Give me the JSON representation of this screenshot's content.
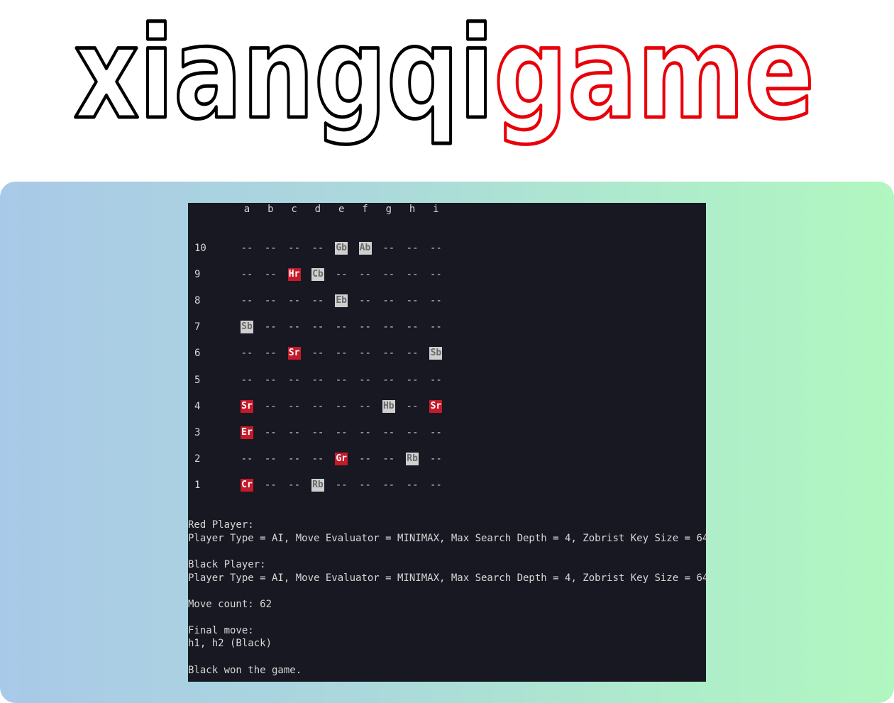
{
  "title": {
    "part1": "xiangqi",
    "part2": "game",
    "color1": "#000000",
    "color2": "#e8000a"
  },
  "panel_gradient": [
    "#a9c9e8",
    "#b1f7c0"
  ],
  "terminal": {
    "columns": [
      "a",
      "b",
      "c",
      "d",
      "e",
      "f",
      "g",
      "h",
      "i"
    ],
    "rows": [
      {
        "label": "10",
        "cells": [
          "--",
          "--",
          "--",
          "--",
          "Gb",
          "Ab",
          "--",
          "--",
          "--"
        ]
      },
      {
        "label": "9",
        "cells": [
          "--",
          "--",
          "Hr",
          "Cb",
          "--",
          "--",
          "--",
          "--",
          "--"
        ]
      },
      {
        "label": "8",
        "cells": [
          "--",
          "--",
          "--",
          "--",
          "Eb",
          "--",
          "--",
          "--",
          "--"
        ]
      },
      {
        "label": "7",
        "cells": [
          "Sb",
          "--",
          "--",
          "--",
          "--",
          "--",
          "--",
          "--",
          "--"
        ]
      },
      {
        "label": "6",
        "cells": [
          "--",
          "--",
          "Sr",
          "--",
          "--",
          "--",
          "--",
          "--",
          "Sb"
        ]
      },
      {
        "label": "5",
        "cells": [
          "--",
          "--",
          "--",
          "--",
          "--",
          "--",
          "--",
          "--",
          "--"
        ]
      },
      {
        "label": "4",
        "cells": [
          "Sr",
          "--",
          "--",
          "--",
          "--",
          "--",
          "Hb",
          "--",
          "Sr"
        ]
      },
      {
        "label": "3",
        "cells": [
          "Er",
          "--",
          "--",
          "--",
          "--",
          "--",
          "--",
          "--",
          "--"
        ]
      },
      {
        "label": "2",
        "cells": [
          "--",
          "--",
          "--",
          "--",
          "Gr",
          "--",
          "--",
          "Rb",
          "--"
        ]
      },
      {
        "label": "1",
        "cells": [
          "Cr",
          "--",
          "--",
          "Rb",
          "--",
          "--",
          "--",
          "--",
          "--"
        ]
      }
    ],
    "red_player_header": "Red Player:",
    "red_player_info": "Player Type = AI, Move Evaluator = MINIMAX, Max Search Depth = 4, Zobrist Key Size = 64",
    "black_player_header": "Black Player:",
    "black_player_info": "Player Type = AI, Move Evaluator = MINIMAX, Max Search Depth = 4, Zobrist Key Size = 64",
    "move_count": "Move count: 62",
    "final_move_header": "Final move:",
    "final_move": "h1, h2 (Black)",
    "result": "Black won the game.",
    "colors": {
      "red_piece": "#c51a2a",
      "black_piece": "#cfcfcf",
      "background": "#181822"
    }
  }
}
